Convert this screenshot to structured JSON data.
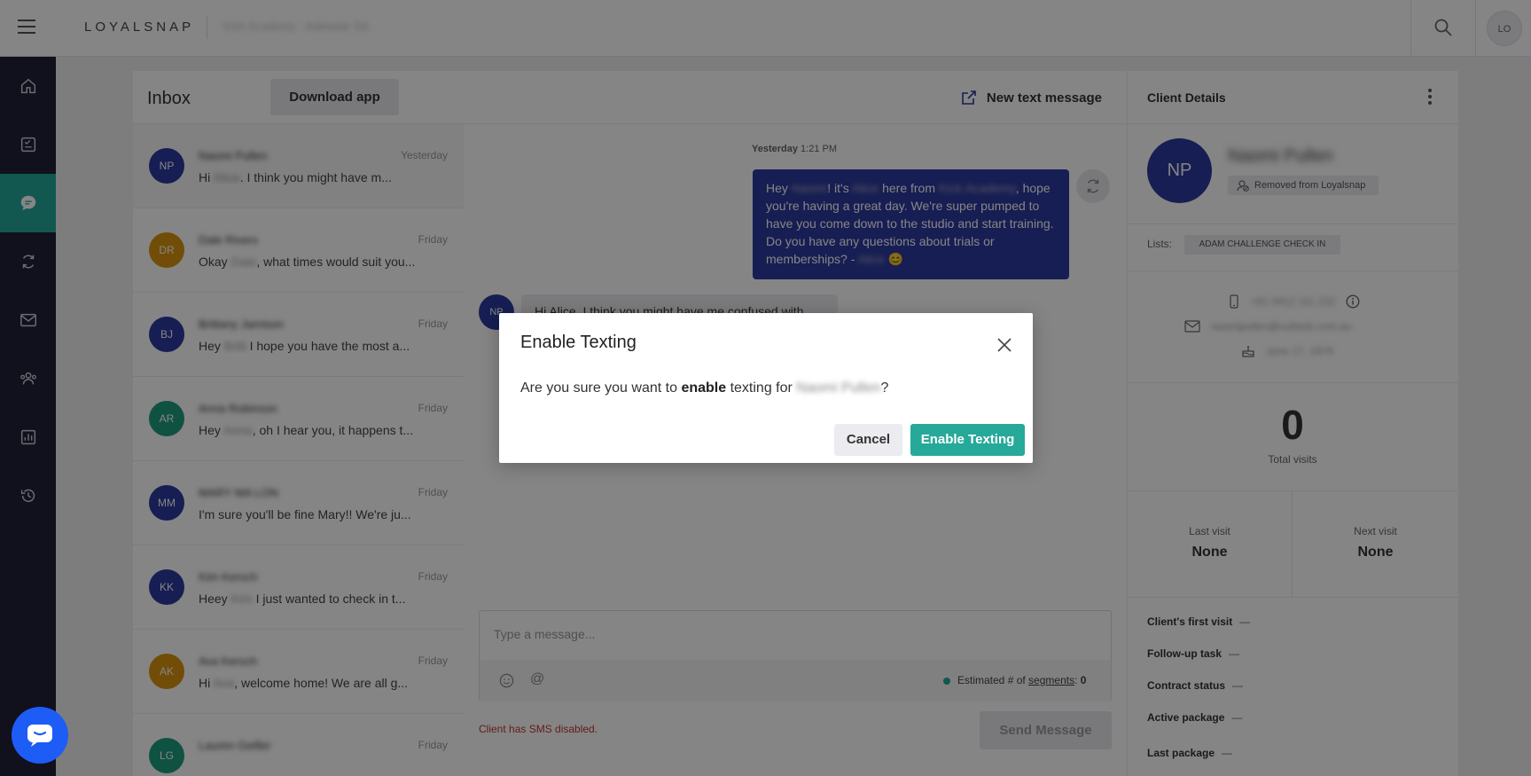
{
  "topbar": {
    "logo": "LOYALSNAP",
    "business_name": "Kick Academy · Adelaide SA",
    "user_initials": "LO"
  },
  "sidebar": {
    "items": [
      {
        "name": "home-icon",
        "active": false
      },
      {
        "name": "tasks-icon",
        "active": false
      },
      {
        "name": "inbox-icon",
        "active": true
      },
      {
        "name": "automations-icon",
        "active": false
      },
      {
        "name": "email-icon",
        "active": false
      },
      {
        "name": "clients-icon",
        "active": false
      },
      {
        "name": "reports-icon",
        "active": false
      },
      {
        "name": "history-icon",
        "active": false
      }
    ]
  },
  "inbox": {
    "title": "Inbox",
    "download_label": "Download app",
    "conversations": [
      {
        "initials": "NP",
        "color": "#2b3aa0",
        "name": "Naomi Pullen",
        "date": "Yesterday",
        "preview_pre": "Hi ",
        "preview_blur": "Alice",
        "preview_post": ". I think you might have m..."
      },
      {
        "initials": "DR",
        "color": "#d9950f",
        "name": "Dale Rivers",
        "date": "Friday",
        "preview_pre": "Okay ",
        "preview_blur": "Dale",
        "preview_post": ", what times would suit you..."
      },
      {
        "initials": "BJ",
        "color": "#2b3aa0",
        "name": "Brittany Jamison",
        "date": "Friday",
        "preview_pre": "Hey ",
        "preview_blur": "Britt",
        "preview_post": " I hope you have the most a..."
      },
      {
        "initials": "AR",
        "color": "#1f9e7f",
        "name": "Anna Robinson",
        "date": "Friday",
        "preview_pre": "Hey ",
        "preview_blur": "Anna",
        "preview_post": ", oh I hear you, it happens t..."
      },
      {
        "initials": "MM",
        "color": "#2b3aa0",
        "name": "MARY MA LON",
        "date": "Friday",
        "preview_pre": "I'm sure you'll be fine Mary!! We're ju...",
        "preview_blur": "",
        "preview_post": ""
      },
      {
        "initials": "KK",
        "color": "#2b3aa0",
        "name": "Kim Kersch",
        "date": "Friday",
        "preview_pre": "Heey ",
        "preview_blur": "Kim",
        "preview_post": " I just wanted to check in t..."
      },
      {
        "initials": "AK",
        "color": "#d9950f",
        "name": "Ava Kersch",
        "date": "Friday",
        "preview_pre": "Hi ",
        "preview_blur": "Ava",
        "preview_post": ", welcome home! We are all g..."
      },
      {
        "initials": "LG",
        "color": "#1f9e7f",
        "name": "Lauren Geiller",
        "date": "Friday",
        "preview_pre": "",
        "preview_blur": "",
        "preview_post": ""
      }
    ]
  },
  "conversation": {
    "new_message_label": "New text message",
    "timestamp_day": "Yesterday",
    "timestamp_time": "1:21 PM",
    "outgoing": {
      "p1": "Hey ",
      "b1": "Naomi",
      "p2": "! it's ",
      "b2": "Alice",
      "p3": " here from ",
      "b3": "Kick Academy",
      "p4": ", hope you're having a great day. We're super pumped to have you come down to the studio and start training. Do you have any questions about trials or memberships? - ",
      "b4": "Alice",
      "emoji": "😊"
    },
    "incoming_avatar": "NP",
    "incoming_text": "Hi Alice. I think you might have me confused with",
    "composer_placeholder": "Type a message...",
    "estimate_prefix": "Estimated # of ",
    "estimate_link": "segments",
    "estimate_suffix": ": ",
    "estimate_value": "0",
    "sms_disabled": "Client has SMS disabled.",
    "send_label": "Send Message"
  },
  "client": {
    "title": "Client Details",
    "initials": "NP",
    "name": "Naomi Pullen",
    "removed_label": "Removed from Loyalsnap",
    "lists_label": "Lists:",
    "list_tag": "ADAM CHALLENGE CHECK IN",
    "phone": "+61 0412 111 222",
    "email": "naomipullen@outlook.com.au",
    "birthday": "June 17, 1979",
    "total_visits": "0",
    "total_visits_label": "Total visits",
    "last_visit_label": "Last visit",
    "last_visit_value": "None",
    "next_visit_label": "Next visit",
    "next_visit_value": "None",
    "details": [
      {
        "label": "Client's first visit",
        "value": "—"
      },
      {
        "label": "Follow-up task",
        "value": "—"
      },
      {
        "label": "Contract status",
        "value": "—"
      },
      {
        "label": "Active package",
        "value": "—"
      },
      {
        "label": "Last package",
        "value": "—"
      }
    ]
  },
  "modal": {
    "title": "Enable Texting",
    "body_pre": "Are you sure you want to ",
    "body_bold": "enable",
    "body_mid": " texting for ",
    "body_name": "Naomi Pullen",
    "body_post": "?",
    "cancel_label": "Cancel",
    "enable_label": "Enable Texting"
  },
  "colors": {
    "accent": "#26a999",
    "brand_blue": "#2b3aa0",
    "sidebar": "#1f2236",
    "error": "#c0392b",
    "chat_launcher": "#1e5cf6"
  }
}
